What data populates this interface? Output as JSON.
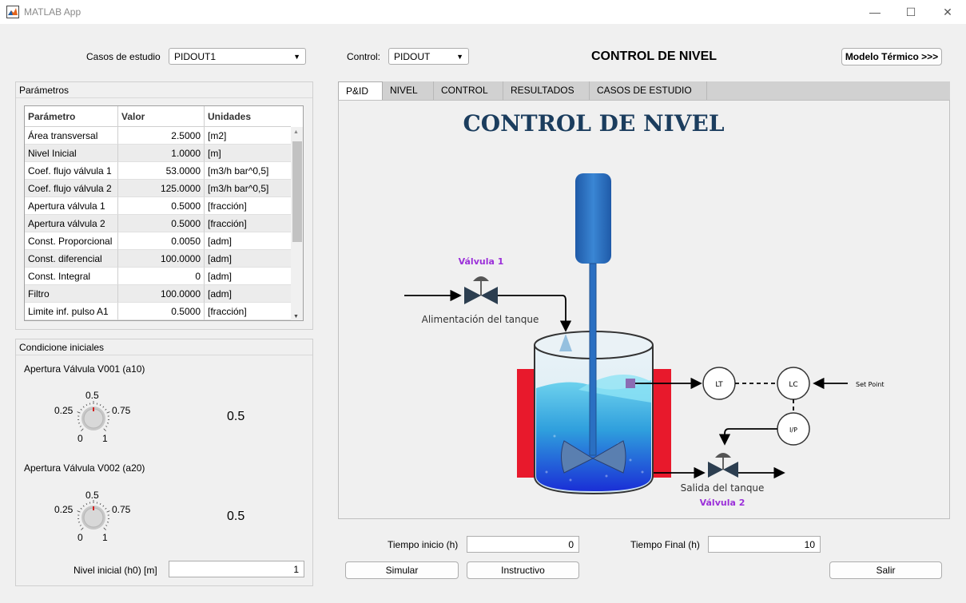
{
  "window": {
    "title": "MATLAB App",
    "minimize_glyph": "—",
    "maximize_glyph": "☐",
    "close_glyph": "✕"
  },
  "header": {
    "casos_label": "Casos de estudio",
    "casos_value": "PIDOUT1",
    "control_label": "Control:",
    "control_value": "PIDOUT",
    "page_title": "CONTROL DE NIVEL",
    "thermal_button": "Modelo Térmico >>>"
  },
  "parametros": {
    "title": "Parámetros",
    "columns": [
      "Parámetro",
      "Valor",
      "Unidades"
    ],
    "rows": [
      [
        "Área transversal",
        "2.5000",
        "[m2]"
      ],
      [
        "Nivel Inicial",
        "1.0000",
        "[m]"
      ],
      [
        "Coef. flujo válvula 1",
        "53.0000",
        "[m3/h bar^0,5]"
      ],
      [
        "Coef. flujo válvula 2",
        "125.0000",
        "[m3/h bar^0,5]"
      ],
      [
        "Apertura válvula 1",
        "0.5000",
        "[fracción]"
      ],
      [
        "Apertura válvula 2",
        "0.5000",
        "[fracción]"
      ],
      [
        "Const. Proporcional",
        "0.0050",
        "[adm]"
      ],
      [
        "Const. diferencial",
        "100.0000",
        "[adm]"
      ],
      [
        "Const. Integral",
        "0",
        "[adm]"
      ],
      [
        "Filtro",
        "100.0000",
        "[adm]"
      ],
      [
        "Limite inf. pulso A1",
        "0.5000",
        "[fracción]"
      ]
    ]
  },
  "condiciones": {
    "title": "Condicione iniciales",
    "knob1": {
      "label": "Apertura Válvula V001 (a10)",
      "ticks": [
        "0",
        "0.25",
        "0.5",
        "0.75",
        "1"
      ],
      "value": 0.5,
      "display": "0.5"
    },
    "knob2": {
      "label": "Apertura Válvula V002 (a20)",
      "ticks": [
        "0",
        "0.25",
        "0.5",
        "0.75",
        "1"
      ],
      "value": 0.5,
      "display": "0.5"
    },
    "nivel_label": "Nivel inicial (h0) [m]",
    "nivel_value": "1"
  },
  "tabs": [
    {
      "label": "P&ID",
      "active": true
    },
    {
      "label": "NIVEL",
      "active": false
    },
    {
      "label": "CONTROL",
      "active": false
    },
    {
      "label": "RESULTADOS",
      "active": false
    },
    {
      "label": "CASOS DE ESTUDIO",
      "active": false
    }
  ],
  "diagram": {
    "title": "CONTROL DE NIVEL",
    "valve1_label": "Válvula 1",
    "feed_label": "Alimentación del tanque",
    "lt_label": "LT",
    "lc_label": "LC",
    "ip_label": "I/P",
    "setpoint_label": "Set Point",
    "outlet_label": "Salida del tanque",
    "valve2_label": "Válvula 2",
    "title_color": "#1b3d5e",
    "valve_label_color": "#9b30d9",
    "tank_red": "#e8192c"
  },
  "bottom": {
    "tiempo_inicio_label": "Tiempo inicio (h)",
    "tiempo_inicio_value": "0",
    "tiempo_final_label": "Tiempo Final (h)",
    "tiempo_final_value": "10",
    "simular": "Simular",
    "instructivo": "Instructivo",
    "salir": "Salir"
  }
}
